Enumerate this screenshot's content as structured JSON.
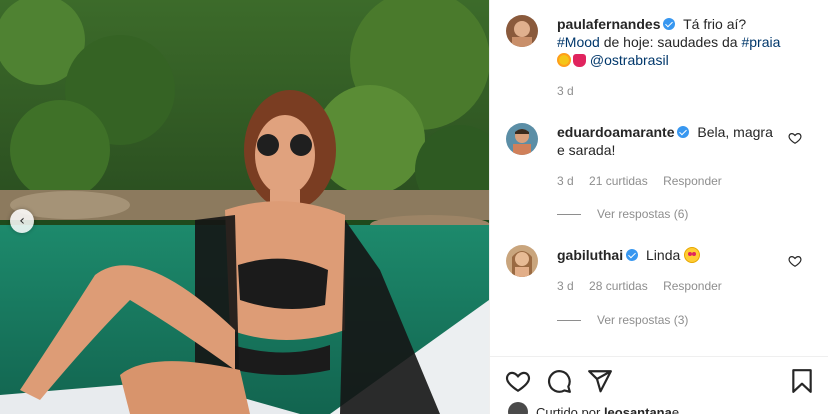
{
  "post": {
    "author": "paulafernandes",
    "caption_line1": "Tá frio aí?",
    "caption_tag_mood": "#Mood",
    "caption_mid": " de hoje: saudades da ",
    "caption_tag_praia": "#praia",
    "caption_mention": "@ostrabrasil",
    "time": "3 d"
  },
  "comments": [
    {
      "user": "eduardoamarante",
      "text_line1": "Bela, magra",
      "text_line2": "e sarada!",
      "time": "3 d",
      "likes": "21 curtidas",
      "reply": "Responder",
      "view_replies": "Ver respostas (6)"
    },
    {
      "user": "gabiluthai",
      "text": "Linda",
      "time": "3 d",
      "likes": "28 curtidas",
      "reply": "Responder",
      "view_replies": "Ver respostas (3)"
    }
  ],
  "footer": {
    "liked_by_prefix": "Curtido por ",
    "liked_by_user": "leosantana",
    "liked_by_suffix": " e"
  },
  "icons": {
    "like": "heart-icon",
    "comment": "comment-icon",
    "share": "paper-plane-icon",
    "save": "bookmark-icon",
    "carousel_prev": "chevron-left-icon",
    "verified": "verified-badge-icon"
  },
  "colors": {
    "link": "#00376b",
    "verified": "#3897f0",
    "secondary_text": "#8e8e8e"
  }
}
